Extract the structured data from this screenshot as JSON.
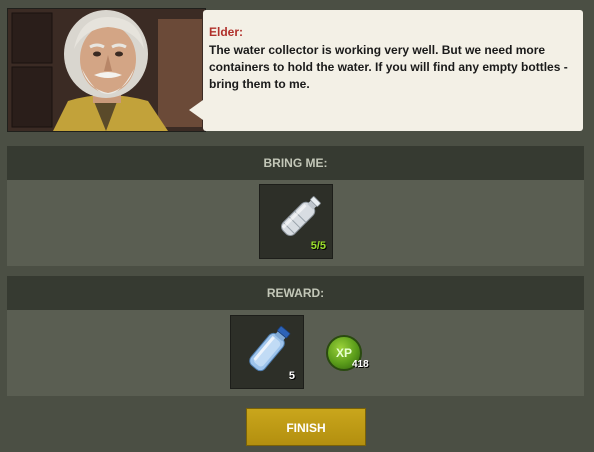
{
  "npc": {
    "name": "Elder:",
    "dialog": "The water collector is working very well. But we need more containers to hold the water. If you will find any empty bottles - bring them to me."
  },
  "bring_section": {
    "header": "BRING ME:",
    "items": [
      {
        "icon": "empty-plastic-bottle-icon",
        "count": "5/5",
        "count_color": "#9be02b"
      }
    ]
  },
  "reward_section": {
    "header": "REWARD:",
    "items": [
      {
        "icon": "water-bottle-icon",
        "count": "5",
        "count_color": "#ffffff"
      }
    ],
    "xp": {
      "label": "XP",
      "value": "418"
    }
  },
  "finish_button": {
    "label": "FINISH"
  },
  "colors": {
    "background": "#4b4f44",
    "speaker_name": "#b0302b",
    "finish_button": "#c9a61c",
    "quest_count_complete": "#9be02b"
  }
}
